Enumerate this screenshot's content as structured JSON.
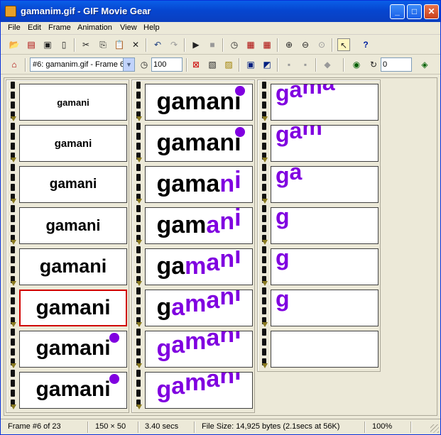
{
  "window": {
    "title": "gamanim.gif - GIF Movie Gear"
  },
  "menu": [
    "File",
    "Edit",
    "Frame",
    "Animation",
    "View",
    "Help"
  ],
  "toolbar1": {
    "icons": [
      "open-icon",
      "filmstrip-icon",
      "save-icon",
      "new-icon",
      "cut-icon",
      "copy-icon",
      "paste-icon",
      "delete-icon",
      "undo-icon",
      "redo-icon",
      "play-icon",
      "stop-icon",
      "timer-icon",
      "strip-a-icon",
      "strip-b-icon",
      "zoom-in-icon",
      "zoom-out-icon",
      "zoom-reset-icon",
      "frame-select-icon",
      "help-icon"
    ]
  },
  "toolbar2": {
    "frame_select": "#6: gamanim.gif - Frame 6",
    "delay_value": "100",
    "loop_value": "0"
  },
  "frames": [
    {
      "strip": 0,
      "word": "gamani",
      "size": 13
    },
    {
      "strip": 0,
      "word": "gamani",
      "size": 15
    },
    {
      "strip": 0,
      "word": "gamani",
      "size": 19
    },
    {
      "strip": 0,
      "word": "gamani",
      "size": 22
    },
    {
      "strip": 0,
      "word": "gamani",
      "size": 27
    },
    {
      "strip": 0,
      "word": "gamani",
      "size": 30,
      "selected": true
    },
    {
      "strip": 0,
      "word": "gamani",
      "size": 30,
      "dot": true
    },
    {
      "strip": 0,
      "word": "gamani",
      "size": 30,
      "dot": true
    },
    {
      "strip": 1,
      "word": "gamani",
      "size": 34,
      "dot": true
    },
    {
      "strip": 1,
      "word": "gamani",
      "size": 34,
      "dot": true
    },
    {
      "strip": 1,
      "word": "gamani",
      "size": 34,
      "purple_from": 4
    },
    {
      "strip": 1,
      "word": "gamani",
      "size": 34,
      "purple_from": 3
    },
    {
      "strip": 1,
      "word": "gamani",
      "size": 34,
      "purple_from": 2
    },
    {
      "strip": 1,
      "word": "gamani",
      "size": 34,
      "purple_from": 1
    },
    {
      "strip": 1,
      "word": "gamani",
      "size": 34,
      "purple_from": 0
    },
    {
      "strip": 1,
      "word": "gamani",
      "size": 34,
      "purple_from": 0
    },
    {
      "strip": 2,
      "word": "gama",
      "size": 32,
      "purple_from": 0
    },
    {
      "strip": 2,
      "word": "gam",
      "size": 32,
      "purple_from": 0
    },
    {
      "strip": 2,
      "word": "ga",
      "size": 32,
      "purple_from": 0
    },
    {
      "strip": 2,
      "word": "g",
      "size": 32,
      "purple_from": 0
    },
    {
      "strip": 2,
      "word": "g",
      "size": 32,
      "purple_from": 0
    },
    {
      "strip": 2,
      "word": "g",
      "size": 32,
      "purple_from": 0
    },
    {
      "strip": 2,
      "word": "",
      "size": 32
    }
  ],
  "status": {
    "frame": "Frame #6 of 23",
    "dims": "150 × 50",
    "duration": "3.40 secs",
    "filesize": "File Size: 14,925 bytes  (2.1secs at 56K)",
    "zoom": "100%"
  },
  "colors": {
    "purple": "#8000e0",
    "selection": "#d00000"
  }
}
